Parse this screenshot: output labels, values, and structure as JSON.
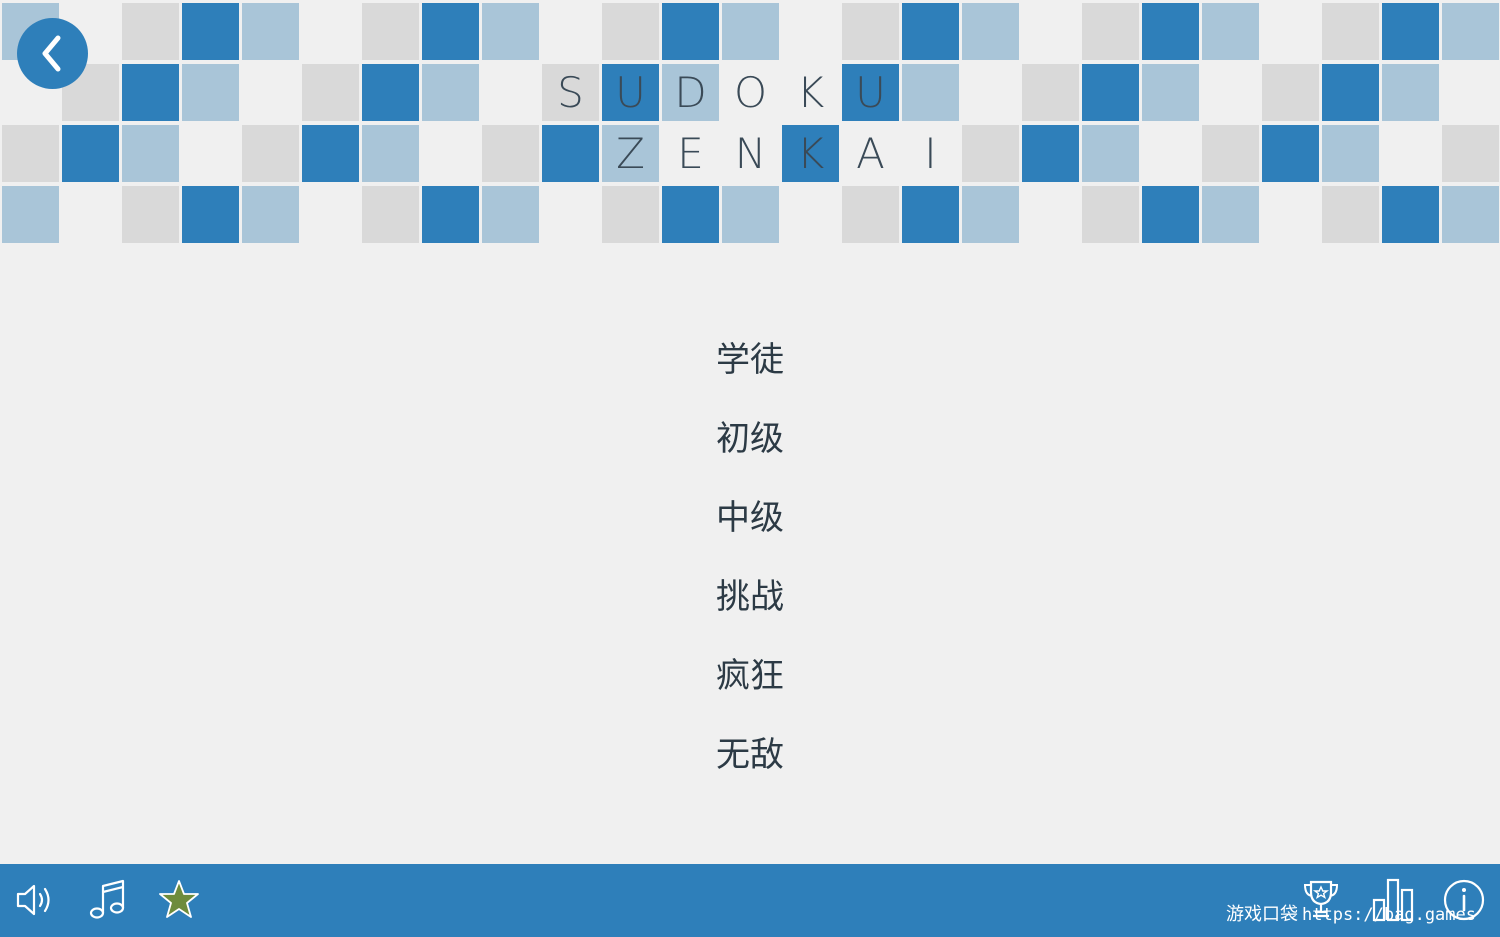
{
  "header": {
    "title_row1": [
      "S",
      "U",
      "D",
      "O",
      "K",
      "U"
    ],
    "title_row2": [
      "Z",
      "E",
      "N",
      "K",
      "A",
      "I"
    ],
    "back_icon": "chevron-left-icon"
  },
  "menu": {
    "items": [
      {
        "label": "学徒"
      },
      {
        "label": "初级"
      },
      {
        "label": "中级"
      },
      {
        "label": "挑战"
      },
      {
        "label": "疯狂"
      },
      {
        "label": "无敌"
      }
    ]
  },
  "bottom_bar": {
    "left_icons": [
      "speaker-icon",
      "music-note-icon",
      "star-icon"
    ],
    "right_icons": [
      "trophy-icon",
      "leaderboard-icon",
      "info-icon"
    ]
  },
  "watermark": {
    "site_name": "游戏口袋",
    "url": "https://bag.games"
  },
  "colors": {
    "tile_dark": "#2e7fba",
    "tile_light": "#a9c5d8",
    "tile_gray": "#d9d9d9",
    "background": "#f0f0f0",
    "bar": "#2e7fba",
    "star": "#6e8c3c",
    "text": "#2c3a45"
  }
}
